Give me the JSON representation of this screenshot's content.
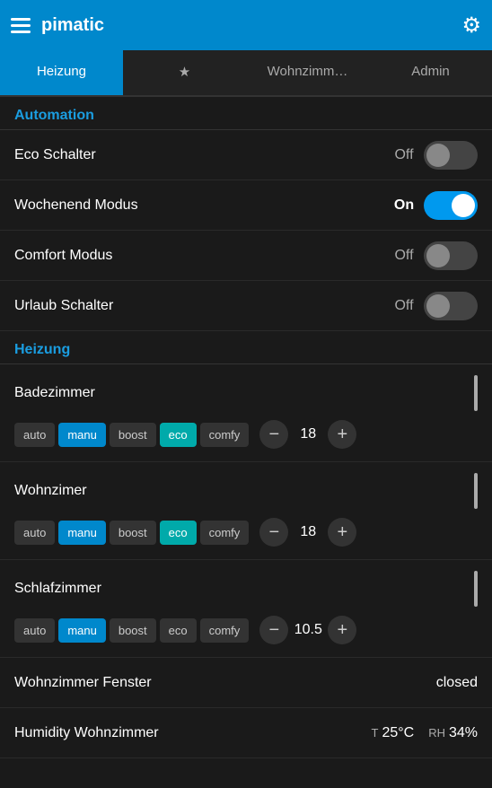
{
  "header": {
    "title": "pimatic",
    "hamburger_icon": "menu-icon",
    "gear_icon": "⚙"
  },
  "tabs": [
    {
      "label": "Heizung",
      "active": true
    },
    {
      "label": "★",
      "active": false
    },
    {
      "label": "Wohnzimm…",
      "active": false
    },
    {
      "label": "Admin",
      "active": false
    }
  ],
  "automation_section": {
    "title": "Automation",
    "items": [
      {
        "label": "Eco Schalter",
        "state": "off",
        "state_text_off": "Off",
        "state_text_on": "On"
      },
      {
        "label": "Wochenend Modus",
        "state": "on",
        "state_text_off": "Off",
        "state_text_on": "On"
      },
      {
        "label": "Comfort Modus",
        "state": "off",
        "state_text_off": "Off",
        "state_text_on": "On"
      },
      {
        "label": "Urlaub Schalter",
        "state": "off",
        "state_text_off": "Off",
        "state_text_on": "On"
      }
    ]
  },
  "heizung_section": {
    "title": "Heizung",
    "devices": [
      {
        "name": "Badezimmer",
        "modes": [
          "auto",
          "manu",
          "boost",
          "eco",
          "comfy"
        ],
        "active_mode": "manu",
        "active_eco_mode": "eco",
        "temp": "18"
      },
      {
        "name": "Wohnzimer",
        "modes": [
          "auto",
          "manu",
          "boost",
          "eco",
          "comfy"
        ],
        "active_mode": "manu",
        "active_eco_mode": "eco",
        "temp": "18"
      },
      {
        "name": "Schlafzimmer",
        "modes": [
          "auto",
          "manu",
          "boost",
          "eco",
          "comfy"
        ],
        "active_mode": "manu",
        "active_eco_mode": "",
        "temp": "10.5"
      }
    ],
    "status_items": [
      {
        "label": "Wohnzimmer Fenster",
        "value": "closed"
      },
      {
        "label": "Humidity Wohnzimmer",
        "t_label": "T",
        "temp": "25°C",
        "rh_label": "RH",
        "rh": "34%"
      }
    ]
  },
  "colors": {
    "accent": "#0088cc",
    "teal": "#00aaaa",
    "bg_dark": "#1a1a1a",
    "header_bg": "#0088cc"
  }
}
